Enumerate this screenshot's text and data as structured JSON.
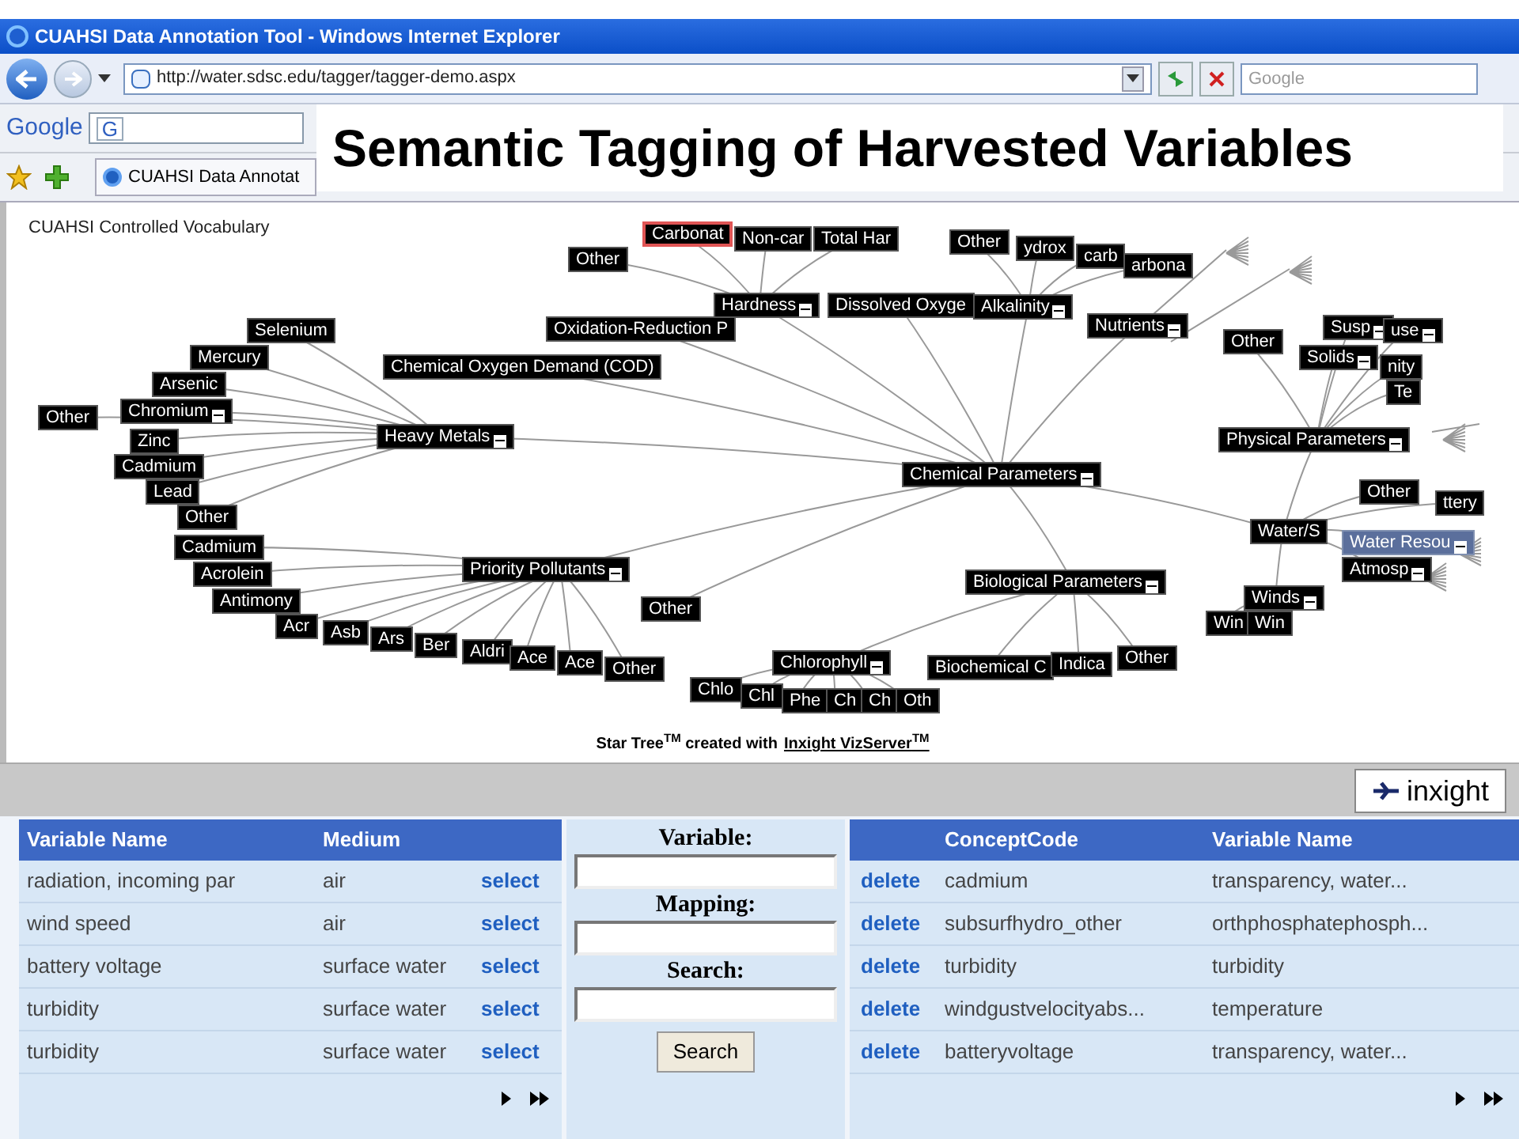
{
  "window": {
    "title": "CUAHSI Data Annotation Tool - Windows Internet Explorer"
  },
  "address_bar": {
    "url": "http://water.sdsc.edu/tagger/tagger-demo.aspx"
  },
  "search_box": {
    "placeholder": "Google"
  },
  "google_toolbar": {
    "logo": "Google",
    "button": "G"
  },
  "tab": {
    "label": "CUAHSI Data Annotat"
  },
  "slide_title": "Semantic Tagging of Harvested Variables",
  "vocabulary": {
    "title": "CUAHSI Controlled Vocabulary",
    "tree": {
      "label": "Chemical Parameters",
      "kind": "normal",
      "expanded": true,
      "children": [
        {
          "label": "Hardness",
          "kind": "normal",
          "expanded": true,
          "children": [
            {
              "label": "Carbonat",
              "kind": "outlined",
              "expanded": false
            },
            {
              "label": "Non-car",
              "kind": "normal",
              "expanded": false
            },
            {
              "label": "Total Har",
              "kind": "normal",
              "expanded": false
            },
            {
              "label": "Other",
              "kind": "normal",
              "expanded": false
            }
          ]
        },
        {
          "label": "Dissolved Oxyge",
          "kind": "normal",
          "expanded": false
        },
        {
          "label": "Alkalinity",
          "kind": "normal",
          "expanded": true,
          "children": [
            {
              "label": "Other",
              "kind": "normal",
              "expanded": false
            },
            {
              "label": "ydrox",
              "kind": "normal",
              "expanded": false
            },
            {
              "label": "carb",
              "kind": "normal",
              "expanded": false
            },
            {
              "label": "arbona",
              "kind": "normal",
              "expanded": false
            }
          ]
        },
        {
          "label": "Oxidation-Reduction P",
          "kind": "normal",
          "expanded": false
        },
        {
          "label": "Nutrients",
          "kind": "normal",
          "expanded": true
        },
        {
          "label": "Chemical Oxygen Demand (COD)",
          "kind": "normal",
          "expanded": false
        },
        {
          "label": "Heavy Metals",
          "kind": "normal",
          "expanded": true,
          "children": [
            {
              "label": "Selenium",
              "kind": "normal",
              "expanded": false
            },
            {
              "label": "Mercury",
              "kind": "normal",
              "expanded": false
            },
            {
              "label": "Arsenic",
              "kind": "normal",
              "expanded": false
            },
            {
              "label": "Chromium",
              "kind": "normal",
              "expanded": true
            },
            {
              "label": "Other",
              "kind": "normal",
              "expanded": false
            },
            {
              "label": "Zinc",
              "kind": "normal",
              "expanded": false
            },
            {
              "label": "Cadmium",
              "kind": "normal",
              "expanded": false
            },
            {
              "label": "Lead",
              "kind": "normal",
              "expanded": false
            },
            {
              "label": "Other",
              "kind": "normal",
              "expanded": false
            }
          ]
        },
        {
          "label": "Water/S",
          "kind": "normal",
          "expanded": false,
          "children": [
            {
              "label": "Physical Parameters",
              "kind": "normal",
              "expanded": true,
              "children": [
                {
                  "label": "Other",
                  "kind": "normal",
                  "expanded": false
                },
                {
                  "label": "Susp",
                  "kind": "normal",
                  "expanded": true
                },
                {
                  "label": "use",
                  "kind": "normal",
                  "expanded": true
                },
                {
                  "label": "Solids",
                  "kind": "normal",
                  "expanded": true
                },
                {
                  "label": "nity",
                  "kind": "normal",
                  "expanded": false
                },
                {
                  "label": "Te",
                  "kind": "normal",
                  "expanded": false
                }
              ]
            },
            {
              "label": "Other",
              "kind": "normal",
              "expanded": false
            },
            {
              "label": "ttery",
              "kind": "normal",
              "expanded": false
            },
            {
              "label": "Water Resou",
              "kind": "highlighted",
              "expanded": true
            },
            {
              "label": "Atmosp",
              "kind": "normal",
              "expanded": true
            },
            {
              "label": "Winds",
              "kind": "normal",
              "expanded": true,
              "children": [
                {
                  "label": "Win",
                  "kind": "normal",
                  "expanded": false
                },
                {
                  "label": "Win",
                  "kind": "normal",
                  "expanded": false
                }
              ]
            }
          ]
        },
        {
          "label": "Priority Pollutants",
          "kind": "normal",
          "expanded": true,
          "children": [
            {
              "label": "Cadmium",
              "kind": "normal",
              "expanded": false
            },
            {
              "label": "Acrolein",
              "kind": "normal",
              "expanded": false
            },
            {
              "label": "Antimony",
              "kind": "normal",
              "expanded": false
            },
            {
              "label": "Acr",
              "kind": "normal",
              "expanded": false
            },
            {
              "label": "Asb",
              "kind": "normal",
              "expanded": false
            },
            {
              "label": "Ars",
              "kind": "normal",
              "expanded": false
            },
            {
              "label": "Ber",
              "kind": "normal",
              "expanded": false
            },
            {
              "label": "Aldri",
              "kind": "normal",
              "expanded": false
            },
            {
              "label": "Ace",
              "kind": "normal",
              "expanded": false
            },
            {
              "label": "Ace",
              "kind": "normal",
              "expanded": false
            },
            {
              "label": "Other",
              "kind": "normal",
              "expanded": false
            }
          ]
        },
        {
          "label": "Biological Parameters",
          "kind": "normal",
          "expanded": true,
          "children": [
            {
              "label": "Chlorophyll",
              "kind": "normal",
              "expanded": true,
              "children": [
                {
                  "label": "Chlo",
                  "kind": "normal",
                  "expanded": false
                },
                {
                  "label": "Chl",
                  "kind": "normal",
                  "expanded": false
                },
                {
                  "label": "Phe",
                  "kind": "normal",
                  "expanded": false
                },
                {
                  "label": "Ch",
                  "kind": "normal",
                  "expanded": false
                },
                {
                  "label": "Ch",
                  "kind": "normal",
                  "expanded": false
                },
                {
                  "label": "Oth",
                  "kind": "normal",
                  "expanded": false
                }
              ]
            },
            {
              "label": "Biochemical C",
              "kind": "normal",
              "expanded": false
            },
            {
              "label": "Indica",
              "kind": "normal",
              "expanded": false
            },
            {
              "label": "Other",
              "kind": "normal",
              "expanded": false
            }
          ]
        },
        {
          "label": "Other",
          "kind": "normal",
          "expanded": false
        }
      ]
    },
    "credit": "Star Tree$^{TM}$ created with",
    "credit_link": "Inxight VizServer$^{TM}$"
  },
  "logo": "inxight",
  "variables_table": {
    "columns": [
      "Variable Name",
      "Medium"
    ],
    "rows": [
      {
        "variable_name": "radiation, incoming par",
        "medium": "air",
        "action": "select"
      },
      {
        "variable_name": "wind speed",
        "medium": "air",
        "action": "select"
      },
      {
        "variable_name": "battery voltage",
        "medium": "surface water",
        "action": "select"
      },
      {
        "variable_name": "turbidity",
        "medium": "surface water",
        "action": "select"
      },
      {
        "variable_name": "turbidity",
        "medium": "surface water",
        "action": "select"
      }
    ]
  },
  "form": {
    "fields": [
      {
        "label": "Variable:"
      },
      {
        "label": "Mapping:"
      },
      {
        "label": "Search:"
      }
    ],
    "button": "Search"
  },
  "mappings_table": {
    "columns": [
      "ConceptCode",
      "Variable Name"
    ],
    "rows": [
      {
        "action": "delete",
        "concept_code": "cadmium",
        "variable_name": "transparency, water..."
      },
      {
        "action": "delete",
        "concept_code": "subsurfhydro_other",
        "variable_name": "orthphosphatephosph..."
      },
      {
        "action": "delete",
        "concept_code": "turbidity",
        "variable_name": "turbidity"
      },
      {
        "action": "delete",
        "concept_code": "windgustvelocityabs...",
        "variable_name": "temperature"
      },
      {
        "action": "delete",
        "concept_code": "batteryvoltage",
        "variable_name": "transparency, water..."
      }
    ]
  }
}
